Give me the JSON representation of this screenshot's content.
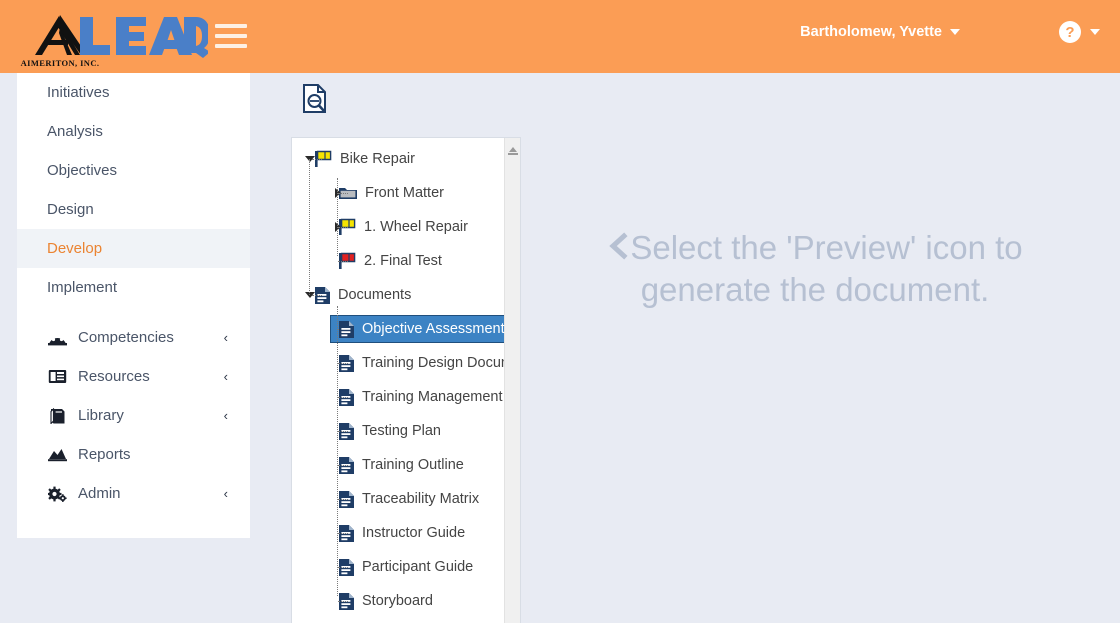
{
  "brand": {
    "company_name": "AIMERITON, INC.",
    "product_name": "LEAD",
    "header_color": "#fb9d55",
    "logo_blue": "#4a7fc8"
  },
  "header": {
    "menu_toggle_name": "hamburger-menu",
    "user_name": "Bartholomew, Yvette",
    "help_label": "?"
  },
  "sidebar": {
    "items": [
      {
        "label": "Initiatives",
        "icon": "",
        "active": false,
        "expandable": false
      },
      {
        "label": "Analysis",
        "icon": "",
        "active": false,
        "expandable": false
      },
      {
        "label": "Objectives",
        "icon": "",
        "active": false,
        "expandable": false
      },
      {
        "label": "Design",
        "icon": "",
        "active": false,
        "expandable": false
      },
      {
        "label": "Develop",
        "icon": "",
        "active": true,
        "expandable": false
      },
      {
        "label": "Implement",
        "icon": "",
        "active": false,
        "expandable": false
      },
      {
        "label": "Competencies",
        "icon": "dashboard-icon",
        "active": false,
        "expandable": true
      },
      {
        "label": "Resources",
        "icon": "newspaper-icon",
        "active": false,
        "expandable": true
      },
      {
        "label": "Library",
        "icon": "book-icon",
        "active": false,
        "expandable": true
      },
      {
        "label": "Reports",
        "icon": "chart-area-icon",
        "active": false,
        "expandable": false
      },
      {
        "label": "Admin",
        "icon": "gears-icon",
        "active": false,
        "expandable": true
      }
    ],
    "expand_chevron": "‹"
  },
  "toolbar": {
    "preview_icon_name": "document-preview-icon"
  },
  "tree": {
    "nodes": [
      {
        "label": "Bike Repair",
        "icon": "flag-yellow-icon",
        "depth": 0,
        "state": "expanded",
        "selected": false
      },
      {
        "label": "Front Matter",
        "icon": "folder-icon",
        "depth": 1,
        "state": "collapsed",
        "selected": false
      },
      {
        "label": "1. Wheel Repair",
        "icon": "flag-yellow-icon",
        "depth": 1,
        "state": "collapsed",
        "selected": false
      },
      {
        "label": "2. Final Test",
        "icon": "flag-red-icon",
        "depth": 1,
        "state": "leaf",
        "selected": false
      },
      {
        "label": "Documents",
        "icon": "document-icon",
        "depth": 0,
        "state": "expanded",
        "selected": false
      },
      {
        "label": "Objective Assessment",
        "icon": "document-icon",
        "depth": 1,
        "state": "leaf",
        "selected": true
      },
      {
        "label": "Training Design Document",
        "icon": "document-icon",
        "depth": 1,
        "state": "leaf",
        "selected": false
      },
      {
        "label": "Training Management Plan",
        "icon": "document-icon",
        "depth": 1,
        "state": "leaf",
        "selected": false
      },
      {
        "label": "Testing Plan",
        "icon": "document-icon",
        "depth": 1,
        "state": "leaf",
        "selected": false
      },
      {
        "label": "Training Outline",
        "icon": "document-icon",
        "depth": 1,
        "state": "leaf",
        "selected": false
      },
      {
        "label": "Traceability Matrix",
        "icon": "document-icon",
        "depth": 1,
        "state": "leaf",
        "selected": false
      },
      {
        "label": "Instructor Guide",
        "icon": "document-icon",
        "depth": 1,
        "state": "leaf",
        "selected": false
      },
      {
        "label": "Participant Guide",
        "icon": "document-icon",
        "depth": 1,
        "state": "leaf",
        "selected": false
      },
      {
        "label": "Storyboard",
        "icon": "document-icon",
        "depth": 1,
        "state": "leaf",
        "selected": false
      }
    ],
    "selected_color": "#3c83c4"
  },
  "main": {
    "empty_state_line1": "Select the 'Preview' icon to",
    "empty_state_line2": "generate the document.",
    "empty_state_color": "#b6c0d2"
  }
}
